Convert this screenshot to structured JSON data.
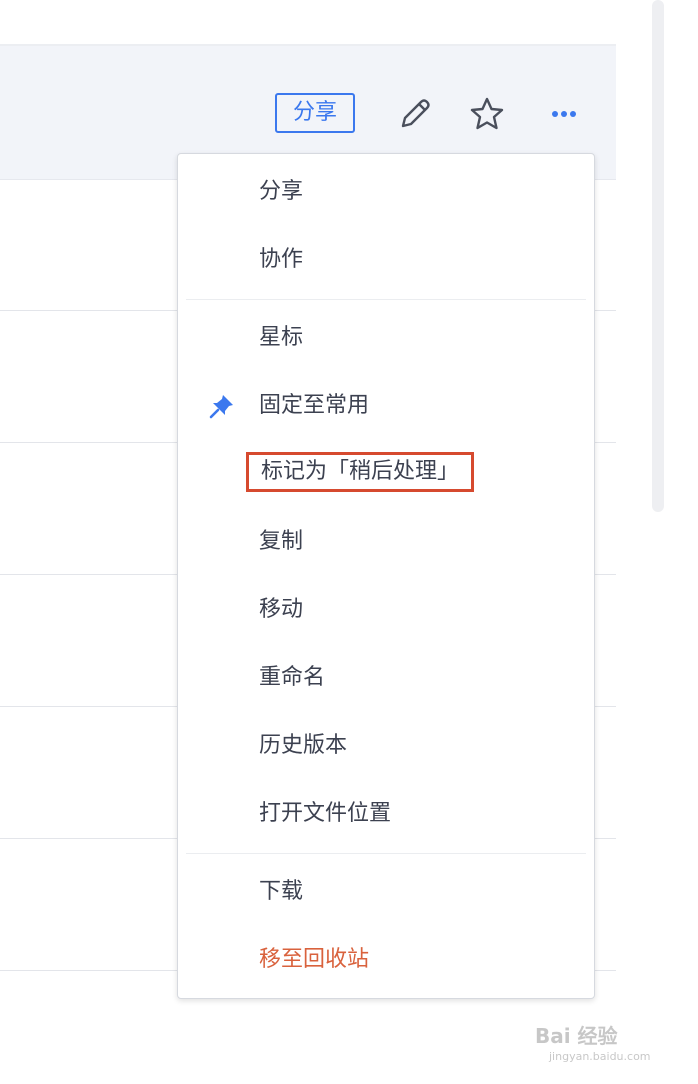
{
  "toolbar": {
    "share_label": "分享",
    "icons": [
      "pencil-icon",
      "star-icon",
      "more-icon"
    ]
  },
  "menu": {
    "items": [
      {
        "label": "分享"
      },
      {
        "label": "协作"
      },
      {
        "label": "星标"
      },
      {
        "label": "固定至常用",
        "icon": "pin-icon"
      },
      {
        "label": "标记为「稍后处理」",
        "highlighted": true
      },
      {
        "label": "复制"
      },
      {
        "label": "移动"
      },
      {
        "label": "重命名"
      },
      {
        "label": "历史版本"
      },
      {
        "label": "打开文件位置"
      },
      {
        "label": "下载"
      },
      {
        "label": "移至回收站",
        "danger": true
      }
    ]
  },
  "watermark": {
    "text": "Bai 经验",
    "sub": "jingyan.baidu.com"
  },
  "colors": {
    "accent": "#3b78ee",
    "danger": "#d9623d",
    "highlight_border": "#d64a2f"
  }
}
